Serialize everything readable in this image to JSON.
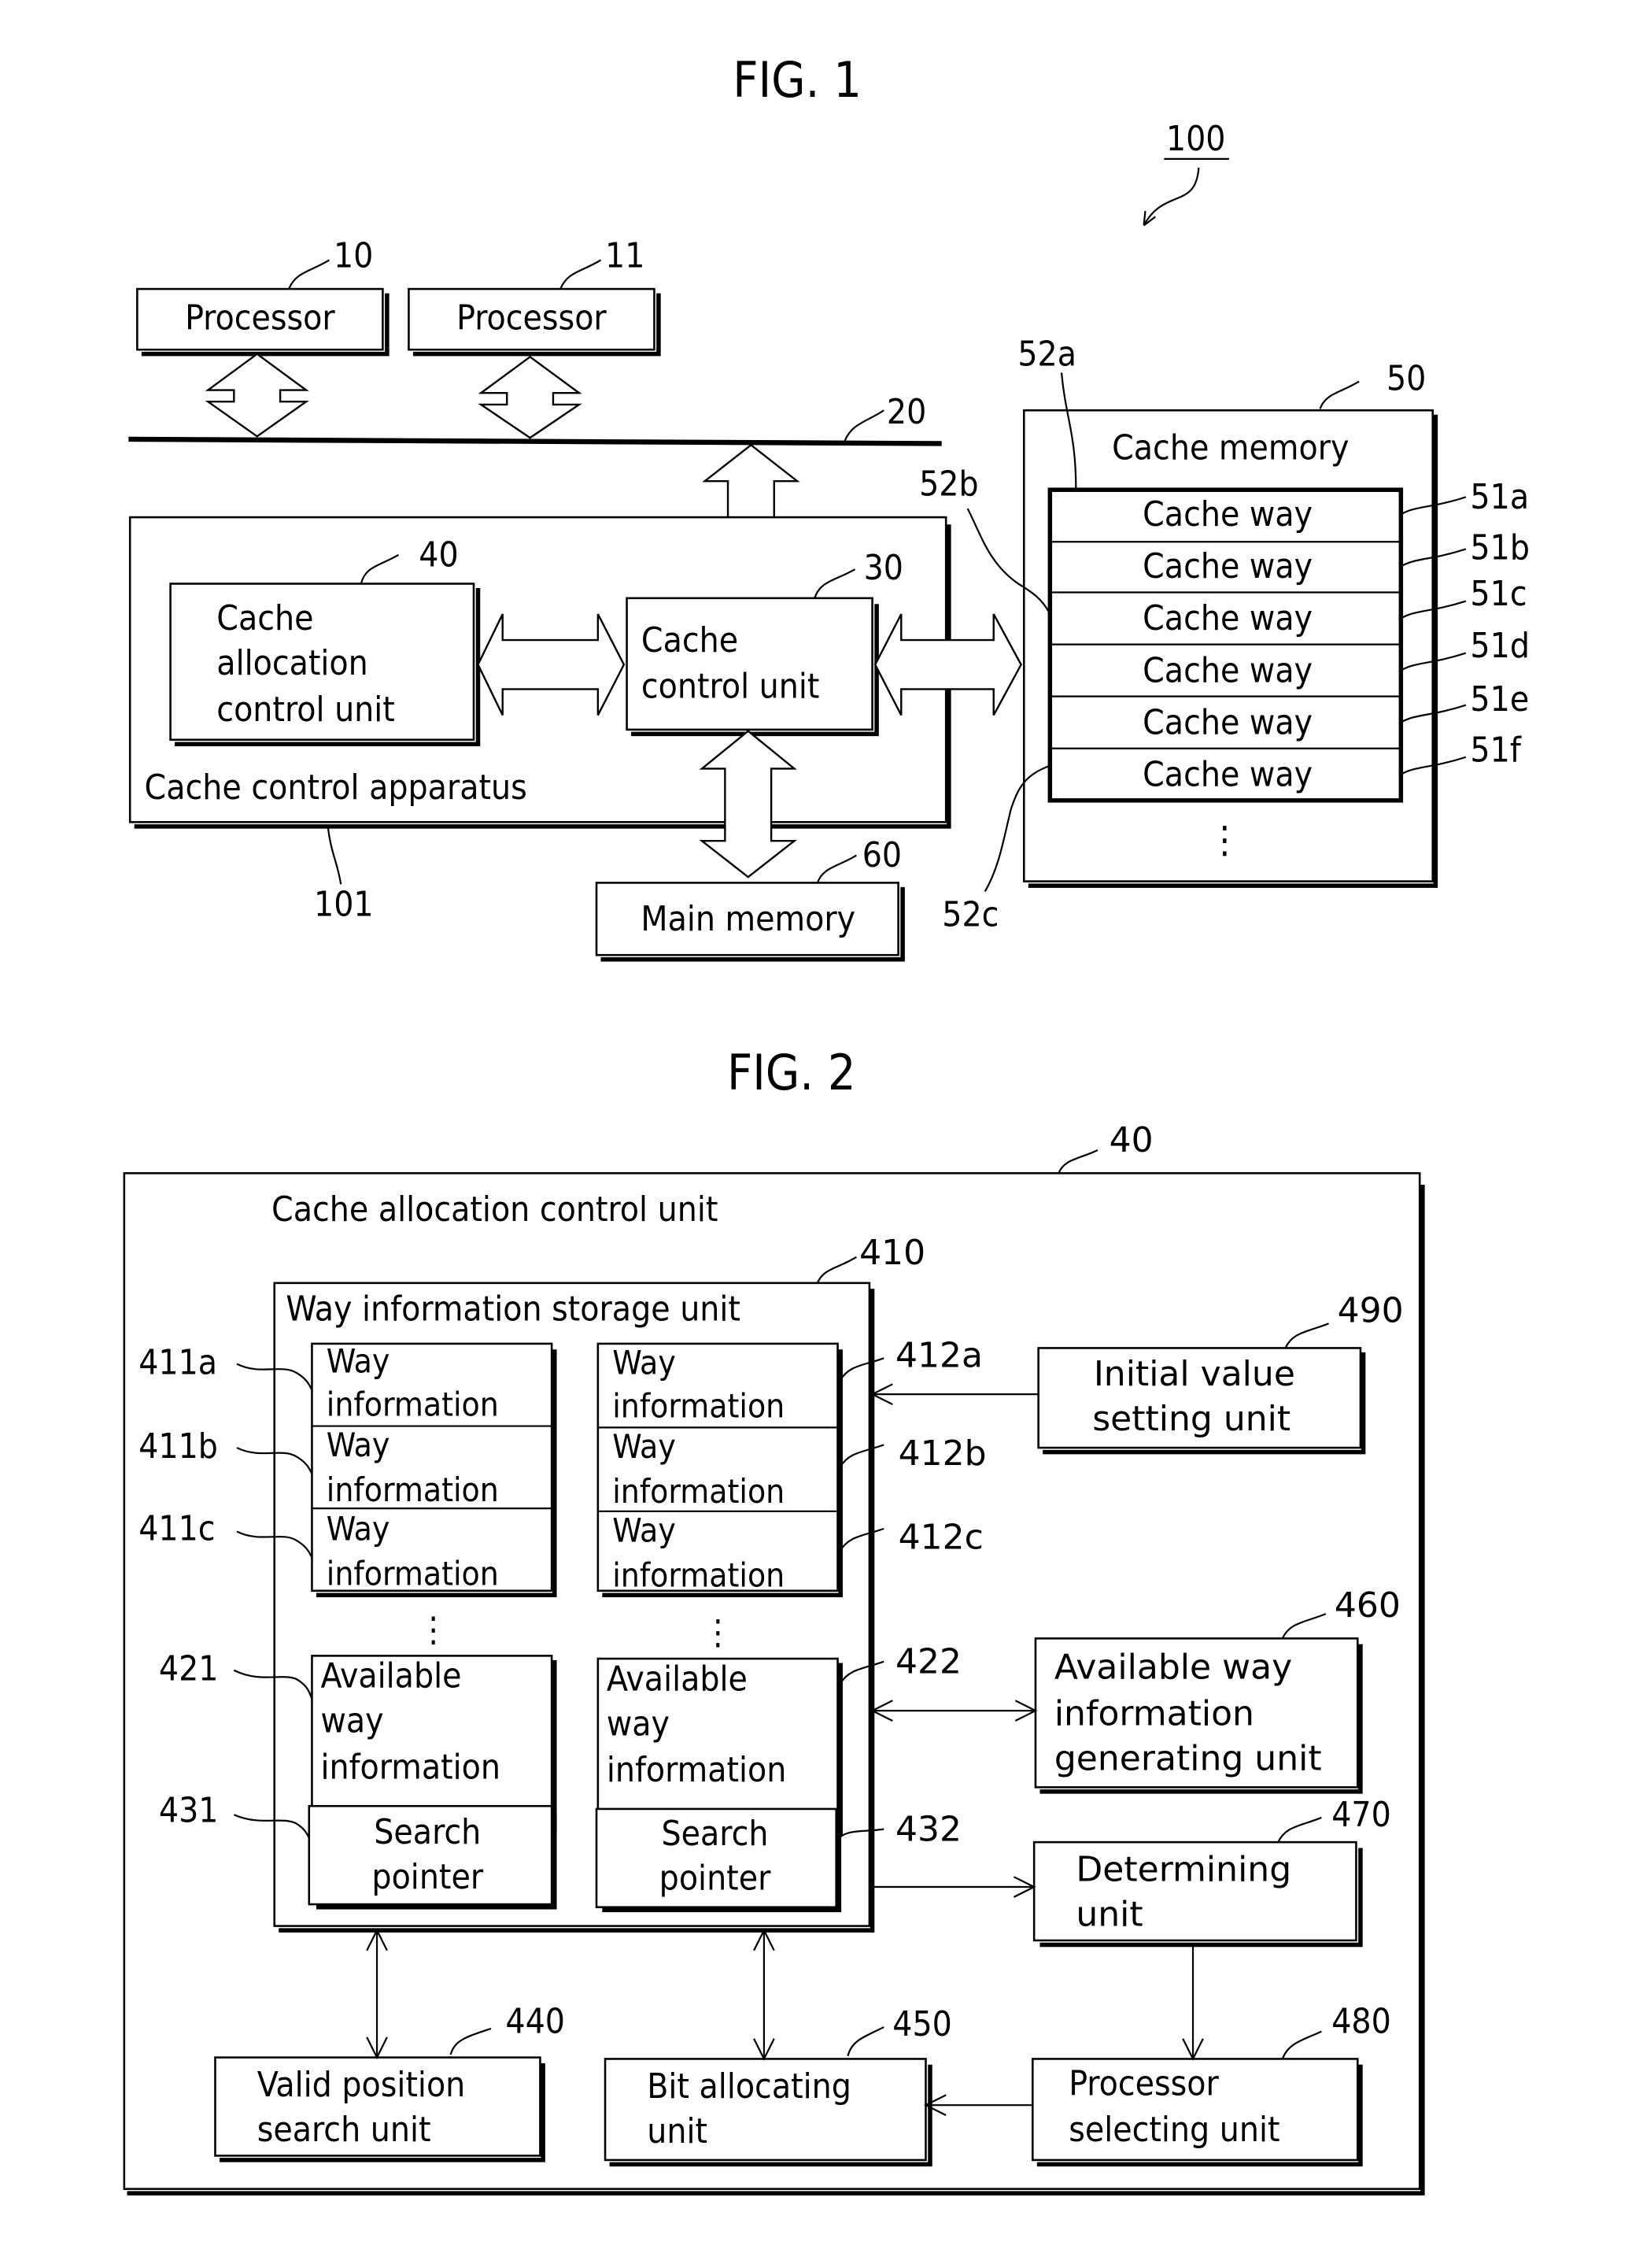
{
  "fig1": {
    "title": "FIG. 1",
    "system_ref": "100",
    "processors": [
      {
        "label": "Processor",
        "ref": "10"
      },
      {
        "label": "Processor",
        "ref": "11"
      }
    ],
    "bus_ref": "20",
    "apparatus": {
      "label": "Cache control apparatus",
      "ref": "101"
    },
    "alloc_unit": {
      "lines": [
        "Cache",
        "allocation",
        "control unit"
      ],
      "ref": "40"
    },
    "control_unit": {
      "lines": [
        "Cache",
        "control unit"
      ],
      "ref": "30"
    },
    "main_memory": {
      "label": "Main memory",
      "ref": "60"
    },
    "cache_memory": {
      "label": "Cache memory",
      "ref": "50",
      "ways": [
        {
          "label": "Cache way",
          "ref": "51a"
        },
        {
          "label": "Cache way",
          "ref": "51b"
        },
        {
          "label": "Cache way",
          "ref": "51c"
        },
        {
          "label": "Cache way",
          "ref": "51d"
        },
        {
          "label": "Cache way",
          "ref": "51e"
        },
        {
          "label": "Cache way",
          "ref": "51f"
        }
      ],
      "group_refs": [
        "52a",
        "52b",
        "52c"
      ],
      "ellipsis": "⋮"
    }
  },
  "fig2": {
    "title": "FIG. 2",
    "outer": {
      "label": "Cache allocation control unit",
      "ref": "40"
    },
    "storage": {
      "label": "Way information storage unit",
      "ref": "410"
    },
    "left_col": {
      "way_info": [
        {
          "lines": [
            "Way",
            "information"
          ],
          "ref": "411a"
        },
        {
          "lines": [
            "Way",
            "information"
          ],
          "ref": "411b"
        },
        {
          "lines": [
            "Way",
            "information"
          ],
          "ref": "411c"
        }
      ],
      "available": {
        "lines": [
          "Available",
          "way",
          "information"
        ],
        "ref": "421"
      },
      "pointer": {
        "lines": [
          "Search",
          "pointer"
        ],
        "ref": "431"
      }
    },
    "right_col": {
      "way_info": [
        {
          "lines": [
            "Way",
            "information"
          ],
          "ref": "412a"
        },
        {
          "lines": [
            "Way",
            "information"
          ],
          "ref": "412b"
        },
        {
          "lines": [
            "Way",
            "information"
          ],
          "ref": "412c"
        }
      ],
      "available": {
        "lines": [
          "Available",
          "way",
          "information"
        ],
        "ref": "422"
      },
      "pointer": {
        "lines": [
          "Search",
          "pointer"
        ],
        "ref": "432"
      }
    },
    "ellipsis": "⋮",
    "initial_value": {
      "lines": [
        "Initial value",
        "setting unit"
      ],
      "ref": "490"
    },
    "avail_gen": {
      "lines": [
        "Available way",
        "information",
        "generating unit"
      ],
      "ref": "460"
    },
    "determining": {
      "lines": [
        "Determining",
        "unit"
      ],
      "ref": "470"
    },
    "processor_sel": {
      "lines": [
        "Processor",
        "selecting unit"
      ],
      "ref": "480"
    },
    "bit_alloc": {
      "lines": [
        "Bit allocating",
        "unit"
      ],
      "ref": "450"
    },
    "valid_search": {
      "lines": [
        "Valid position",
        "search unit"
      ],
      "ref": "440"
    }
  }
}
